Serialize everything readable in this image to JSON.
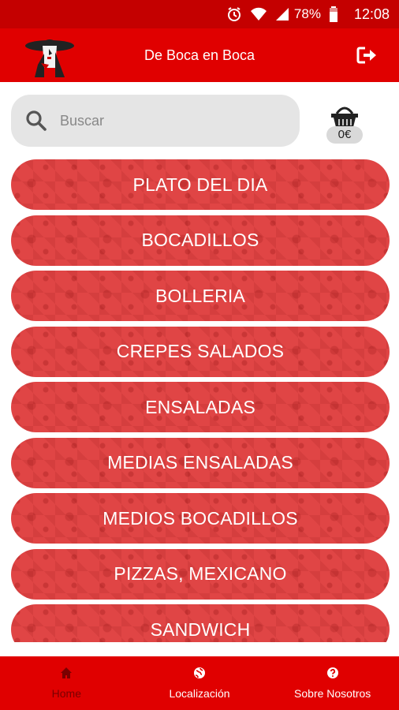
{
  "status_bar": {
    "battery": "78%",
    "time": "12:08"
  },
  "app_bar": {
    "title": "De Boca en Boca"
  },
  "search": {
    "placeholder": "Buscar"
  },
  "cart": {
    "total": "0€"
  },
  "menu": {
    "categories": [
      "PLATO DEL DIA",
      "BOCADILLOS",
      "BOLLERIA",
      "CREPES SALADOS",
      "ENSALADAS",
      "MEDIAS ENSALADAS",
      "MEDIOS BOCADILLOS",
      "PIZZAS, MEXICANO",
      "SANDWICH"
    ]
  },
  "bottom_nav": {
    "items": [
      {
        "label": "Home",
        "icon": "home-icon",
        "active": true
      },
      {
        "label": "Localización",
        "icon": "globe-icon",
        "active": false
      },
      {
        "label": "Sobre Nosotros",
        "icon": "question-icon",
        "active": false
      }
    ]
  },
  "colors": {
    "primary": "#e00000",
    "status_bar": "#c40000",
    "category_bg": "#e04545",
    "active_nav": "#7a0000"
  }
}
